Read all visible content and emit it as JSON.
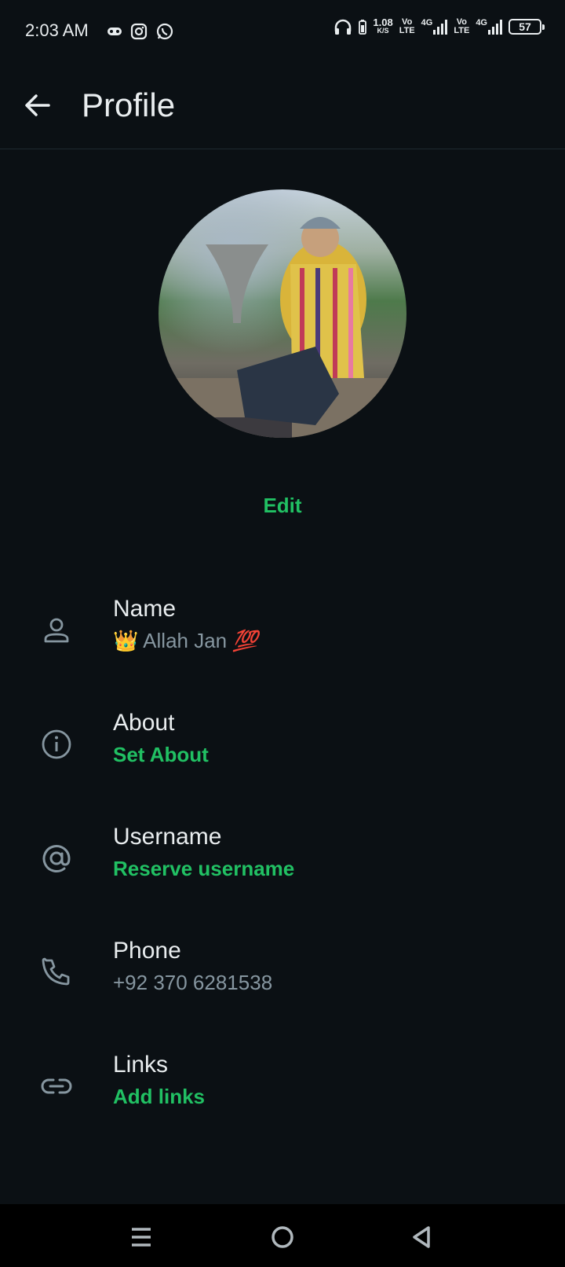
{
  "status_bar": {
    "time": "2:03 AM",
    "speed": "1.08",
    "speed_unit": "K/S",
    "volte1_top": "Vo",
    "volte1_bottom": "LTE",
    "net1": "4G",
    "volte2_top": "Vo",
    "volte2_bottom": "LTE",
    "net2": "4G",
    "battery": "57"
  },
  "app_bar": {
    "title": "Profile"
  },
  "avatar": {
    "edit_label": "Edit"
  },
  "fields": [
    {
      "label": "Name",
      "value": "Allah Jan",
      "icon": "person-icon"
    },
    {
      "label": "About",
      "value": "Set About",
      "icon": "info-icon"
    },
    {
      "label": "Username",
      "value": "Reserve username",
      "icon": "at-icon"
    },
    {
      "label": "Phone",
      "value": "+92 370 6281538",
      "icon": "phone-icon"
    },
    {
      "label": "Links",
      "value": "Add links",
      "icon": "link-icon"
    }
  ],
  "colors": {
    "background": "#0b1014",
    "accent": "#21c063",
    "secondary_text": "#8696a0"
  }
}
